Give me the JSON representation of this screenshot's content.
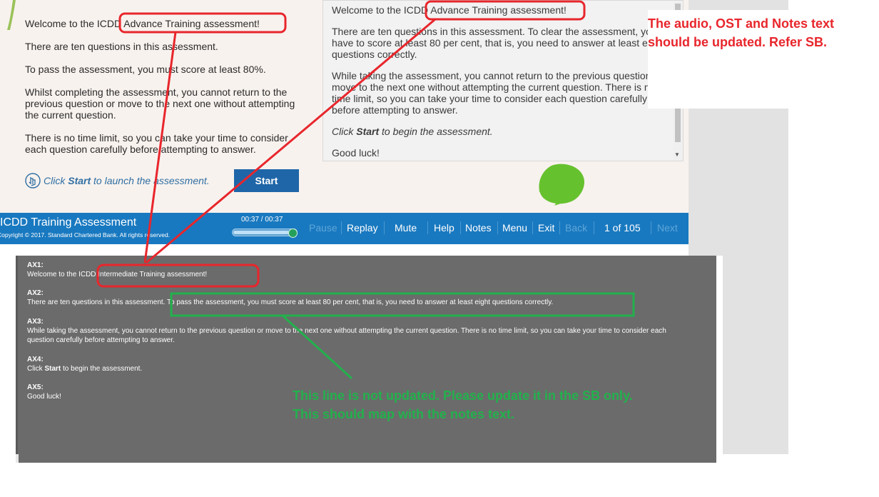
{
  "slide": {
    "welcome_prefix": "Welcome to the ICDD ",
    "welcome_highlight": "Advance Training assessment!",
    "p2": "There are ten questions in this assessment.",
    "p3": "To pass the assessment, you must score at least 80%.",
    "p4": "Whilst completing the assessment, you cannot return to the previous question or move to the next one without attempting the current question.",
    "p5": "There is no time limit, so you can take your time to consider each question carefully before attempting to answer.",
    "click_prefix": "Click ",
    "click_bold": "Start",
    "click_suffix": " to launch the assessment.",
    "start_label": "Start"
  },
  "notes": {
    "welcome_prefix": "Welcome to the ICDD ",
    "welcome_highlight": "Advance Training assessment!",
    "p2": "There are ten questions in this assessment. To clear the assessment, you have to score at least 80 per cent, that is, you need to answer at least eight questions correctly.",
    "p3": "While taking the assessment, you cannot return to the previous question or move to the next one without attempting the current question. There is no time limit, so you can take your time to consider each question carefully before attempting to answer.",
    "p4_prefix": "Click ",
    "p4_bold": "Start",
    "p4_suffix": " to begin the assessment.",
    "p5": "Good luck!"
  },
  "player": {
    "title": "ICDD Training Assessment",
    "copyright": "Copyright © 2017. Standard Chartered Bank. All rights reserved.",
    "time": "00:37 / 00:37",
    "progress": 1.0,
    "buttons": {
      "pause": "Pause",
      "replay": "Replay",
      "mute": "Mute",
      "help": "Help",
      "notes": "Notes",
      "menu": "Menu",
      "exit": "Exit",
      "back": "Back",
      "page": "1 of 105",
      "next": "Next"
    }
  },
  "ax": {
    "ax1_label": "AX1:",
    "ax1_prefix": "Welcome to the ICDD ",
    "ax1_highlight": "Intermediate Training assessment!",
    "ax2_label": "AX2:",
    "ax2_prefix": "There are ten questions in this assessment. ",
    "ax2_highlight": "To pass the assessment, you must score at least 80 per cent, that is, you need to answer at least eight questions correctly.",
    "ax3_label": "AX3:",
    "ax3_text": "While taking the assessment, you cannot return to the previous question or move to the next one without attempting the current question. There is no time limit, so you can take your time to consider each question carefully before attempting to answer.",
    "ax4_label": "AX4:",
    "ax4_prefix": "Click ",
    "ax4_bold": "Start",
    "ax4_suffix": " to begin the assessment.",
    "ax5_label": "AX5:",
    "ax5_text": "Good luck!"
  },
  "annotations": {
    "red_line1": "The audio, OST and Notes text",
    "red_line2": "should be updated. Refer SB.",
    "green_line1": "This line is not updated. Please update it in the SB only.",
    "green_line2": "This should map with the notes text."
  },
  "colors": {
    "annotation_red": "#e8262c",
    "annotation_green": "#22b14c",
    "player_blue": "#1979c0",
    "start_blue": "#1f66a8"
  }
}
